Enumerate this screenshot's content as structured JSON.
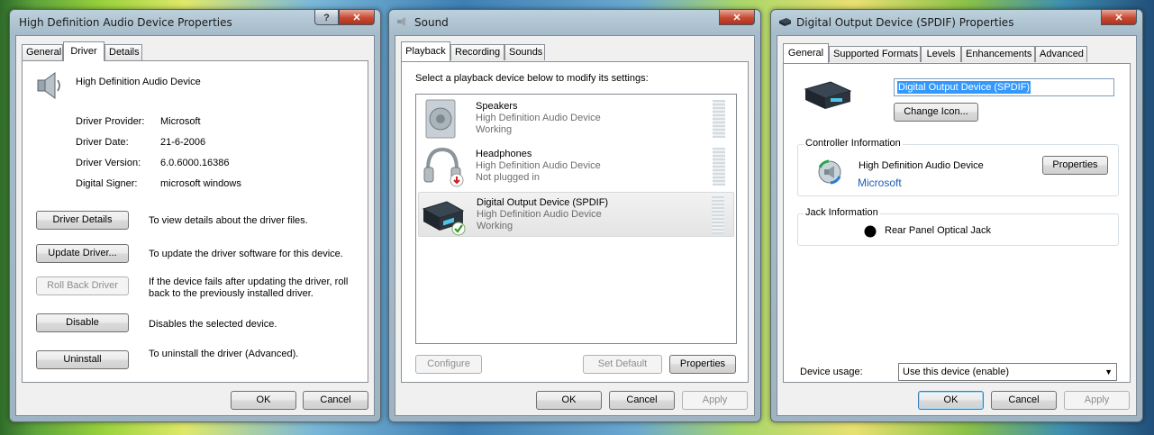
{
  "left_window": {
    "title": "High Definition Audio Device Properties",
    "help_label": "?",
    "close_label": "✕",
    "tabs": [
      "General",
      "Driver",
      "Details"
    ],
    "active_tab": "Driver",
    "device_name": "High Definition Audio Device",
    "info": [
      {
        "label": "Driver Provider:",
        "value": "Microsoft"
      },
      {
        "label": "Driver Date:",
        "value": "21-6-2006"
      },
      {
        "label": "Driver Version:",
        "value": "6.0.6000.16386"
      },
      {
        "label": "Digital Signer:",
        "value": "microsoft windows"
      }
    ],
    "actions": [
      {
        "button": "Driver Details",
        "desc": "To view details about the driver files."
      },
      {
        "button": "Update Driver...",
        "desc": "To update the driver software for this device."
      },
      {
        "button": "Roll Back Driver",
        "desc": "If the device fails after updating the driver, roll back to the previously installed driver."
      },
      {
        "button": "Disable",
        "desc": "Disables the selected device."
      },
      {
        "button": "Uninstall",
        "desc": "To uninstall the driver (Advanced)."
      }
    ],
    "ok": "OK",
    "cancel": "Cancel"
  },
  "middle_window": {
    "title": "Sound",
    "close_label": "✕",
    "tabs": [
      "Playback",
      "Recording",
      "Sounds"
    ],
    "active_tab": "Playback",
    "instruction": "Select a playback device below to modify its settings:",
    "devices": [
      {
        "name": "Speakers",
        "driver": "High Definition Audio Device",
        "status": "Working"
      },
      {
        "name": "Headphones",
        "driver": "High Definition Audio Device",
        "status": "Not plugged in"
      },
      {
        "name": "Digital Output Device (SPDIF)",
        "driver": "High Definition Audio Device",
        "status": "Working"
      }
    ],
    "configure": "Configure",
    "set_default": "Set Default",
    "properties": "Properties",
    "ok": "OK",
    "cancel": "Cancel",
    "apply": "Apply"
  },
  "right_window": {
    "title": "Digital Output Device (SPDIF) Properties",
    "close_label": "✕",
    "tabs": [
      "General",
      "Supported Formats",
      "Levels",
      "Enhancements",
      "Advanced"
    ],
    "active_tab": "General",
    "device_name_value": "Digital Output Device (SPDIF)",
    "change_icon": "Change Icon...",
    "controller_group": "Controller Information",
    "controller_name": "High Definition Audio Device",
    "controller_vendor": "Microsoft",
    "properties": "Properties",
    "jack_group": "Jack Information",
    "jack_name": "Rear Panel Optical Jack",
    "device_usage_label": "Device usage:",
    "device_usage_value": "Use this device (enable)",
    "ok": "OK",
    "cancel": "Cancel",
    "apply": "Apply"
  },
  "colors": {
    "accent": "#3c7fb1",
    "link": "#1e5fb4",
    "selection": "#3399ff"
  }
}
